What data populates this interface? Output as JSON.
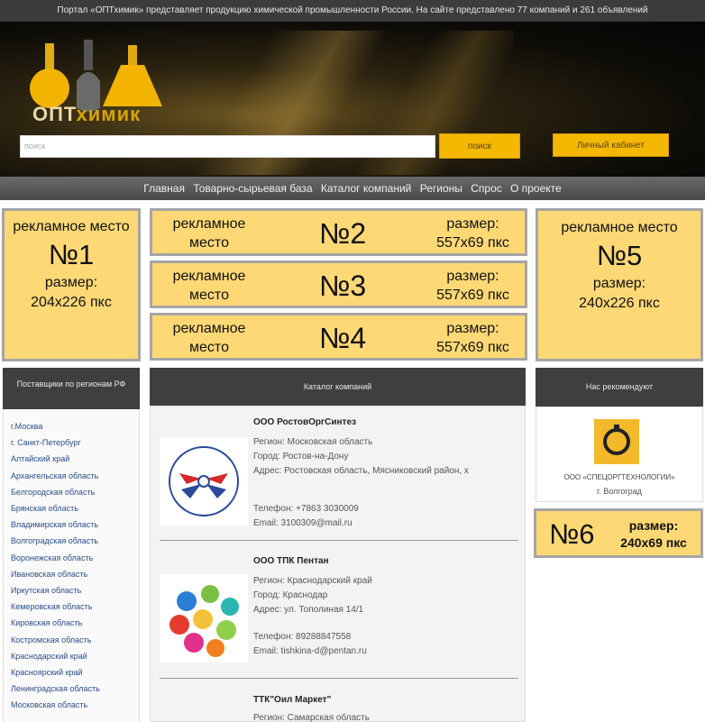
{
  "topbar": {
    "text": "Портал «ОПТхимик» представляет продукцию химической промышленности России. На сайте представлено 77 компаний и 261 объявлений"
  },
  "brand": {
    "logo_part1": "ОПТ",
    "logo_part2": "химик",
    "accent_color": "#f5b800"
  },
  "search": {
    "placeholder": "поиск",
    "button_label": "поиск"
  },
  "cabinet_button": "Личный кабинет",
  "nav": [
    "Главная",
    "Товарно-сырьевая база",
    "Каталог компаний",
    "Регионы",
    "Спрос",
    "О проекте"
  ],
  "ads": {
    "ad1": {
      "label": "рекламное место",
      "number": "№1",
      "size_label": "размер:",
      "size": "204x226 пкс"
    },
    "ad2": {
      "label": "рекламное место",
      "number": "№2",
      "size_label": "размер:",
      "size": "557x69 пкс"
    },
    "ad3": {
      "label": "рекламное место",
      "number": "№3",
      "size_label": "размер:",
      "size": "557x69 пкс"
    },
    "ad4": {
      "label": "рекламное место",
      "number": "№4",
      "size_label": "размер:",
      "size": "557x69 пкс"
    },
    "ad5": {
      "label": "рекламное место",
      "number": "№5",
      "size_label": "размер:",
      "size": "240x226 пкс"
    },
    "ad6": {
      "number": "№6",
      "size_label": "размер:",
      "size": "240x69 пкс"
    }
  },
  "regions": {
    "title": "Поставщики по регионам РФ",
    "items": [
      "г.Москва",
      "г. Санкт-Петербург",
      "Алтайский край",
      "Архангельская область",
      "Белгородская область",
      "Брянская область",
      "Владимирская область",
      "Волгоградская область",
      "Воронежская область",
      "Ивановская область",
      "Иркутская область",
      "Кемеровская область",
      "Кировская область",
      "Костромская область",
      "Краснодарский край",
      "Красноярский край",
      "Ленинградская область",
      "Московская область"
    ]
  },
  "catalog": {
    "title": "Каталог компаний",
    "companies": [
      {
        "name": "ООО РостовОргСинтез",
        "region": "Регион: Московская область",
        "city": "Город: Ростов-на-Дону",
        "address": "Адрес: Ростовская область, Мясниковский район, х",
        "phone": "Телефон: +7863 3030009",
        "email": "Email: 3100309@mail.ru"
      },
      {
        "name": "ООО ТПК Пентан",
        "region": "Регион: Краснодарский край",
        "city": "Город: Краснодар",
        "address": "Адрес: ул. Тополиная 14/1",
        "phone": "Телефон: 89288847558",
        "email": "Email: tishkina-d@pentan.ru"
      },
      {
        "name": "ТТК\"Оил Маркет\"",
        "region": "Регион: Самарская область"
      }
    ]
  },
  "recommend": {
    "title": "Нас рекомендуют",
    "company": "ООО «СПЕЦОРГТЕХНОЛОГИИ»",
    "city": "г. Волгоград"
  }
}
